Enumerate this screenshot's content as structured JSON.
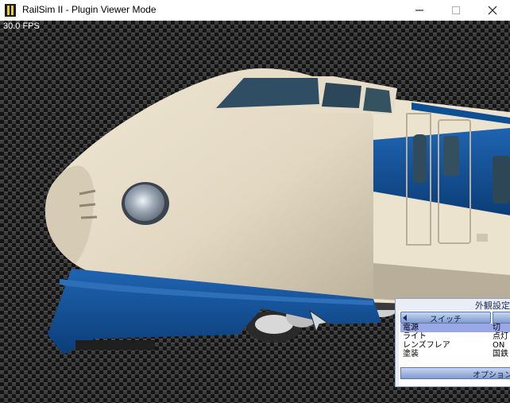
{
  "window": {
    "title": "RailSim II - Plugin Viewer Mode",
    "controls": {
      "minimize": "minimize",
      "maximize": "maximize",
      "close": "close"
    }
  },
  "viewport": {
    "fps": "30.0 FPS",
    "model": {
      "body_color": "#ece3cf",
      "stripe_color": "#0e4e92",
      "window_color": "#2f4b5c"
    }
  },
  "panel": {
    "title": "外観設定",
    "sections": {
      "switch": {
        "label": "スイッチ"
      },
      "option": {
        "label": "オプション"
      }
    },
    "rows": [
      {
        "key": "電源",
        "value": "切",
        "selected": true
      },
      {
        "key": "ライト",
        "value": "点灯",
        "selected": false
      },
      {
        "key": "レンズフレア",
        "value": "ON",
        "selected": false
      },
      {
        "key": "塗装",
        "value": "国鉄",
        "selected": false
      }
    ]
  }
}
